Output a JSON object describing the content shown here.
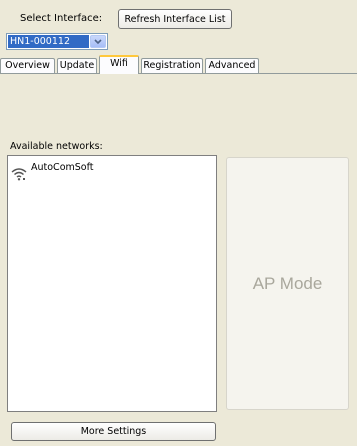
{
  "header": {
    "select_label": "Select Interface:",
    "refresh_label": "Refresh Interface List",
    "interface_value": "HN1-000112"
  },
  "tabs": [
    {
      "label": "Overview",
      "active": false
    },
    {
      "label": "Update",
      "active": false
    },
    {
      "label": "Wifi",
      "active": true
    },
    {
      "label": "Registration",
      "active": false
    },
    {
      "label": "Advanced",
      "active": false
    }
  ],
  "wifi": {
    "available_label": "Available networks:",
    "networks": [
      {
        "name": "AutoComSoft",
        "icon": "wifi-icon"
      }
    ],
    "ap_mode_label": "AP Mode",
    "more_settings_label": "More Settings"
  },
  "colors": {
    "window_bg": "#ece9d8",
    "selection": "#316ac5",
    "active_tab_accent": "#ffc83c",
    "ap_text": "#a9a79c"
  }
}
